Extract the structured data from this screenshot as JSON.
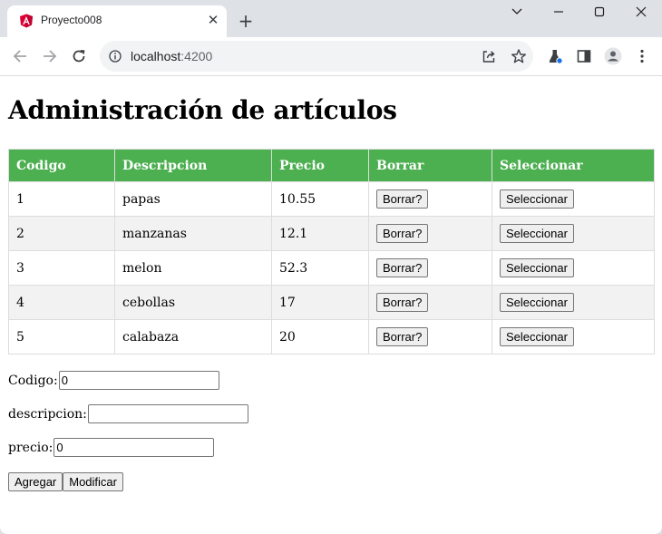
{
  "browser": {
    "tab_title": "Proyecto008",
    "url_host": "localhost",
    "url_port": ":4200"
  },
  "page": {
    "title": "Administración de artículos",
    "table": {
      "headers": [
        "Codigo",
        "Descripcion",
        "Precio",
        "Borrar",
        "Seleccionar"
      ],
      "rows": [
        {
          "codigo": "1",
          "descripcion": "papas",
          "precio": "10.55"
        },
        {
          "codigo": "2",
          "descripcion": "manzanas",
          "precio": "12.1"
        },
        {
          "codigo": "3",
          "descripcion": "melon",
          "precio": "52.3"
        },
        {
          "codigo": "4",
          "descripcion": "cebollas",
          "precio": "17"
        },
        {
          "codigo": "5",
          "descripcion": "calabaza",
          "precio": "20"
        }
      ],
      "delete_label": "Borrar?",
      "select_label": "Seleccionar"
    },
    "form": {
      "codigo_label": "Codigo:",
      "codigo_value": "0",
      "descripcion_label": "descripcion:",
      "descripcion_value": "",
      "precio_label": "precio:",
      "precio_value": "0",
      "add_label": "Agregar",
      "modify_label": "Modificar"
    }
  },
  "colors": {
    "header_bg": "#4caf50",
    "row_alt_bg": "#f2f2f2",
    "chrome_bg": "#dee1e6"
  }
}
